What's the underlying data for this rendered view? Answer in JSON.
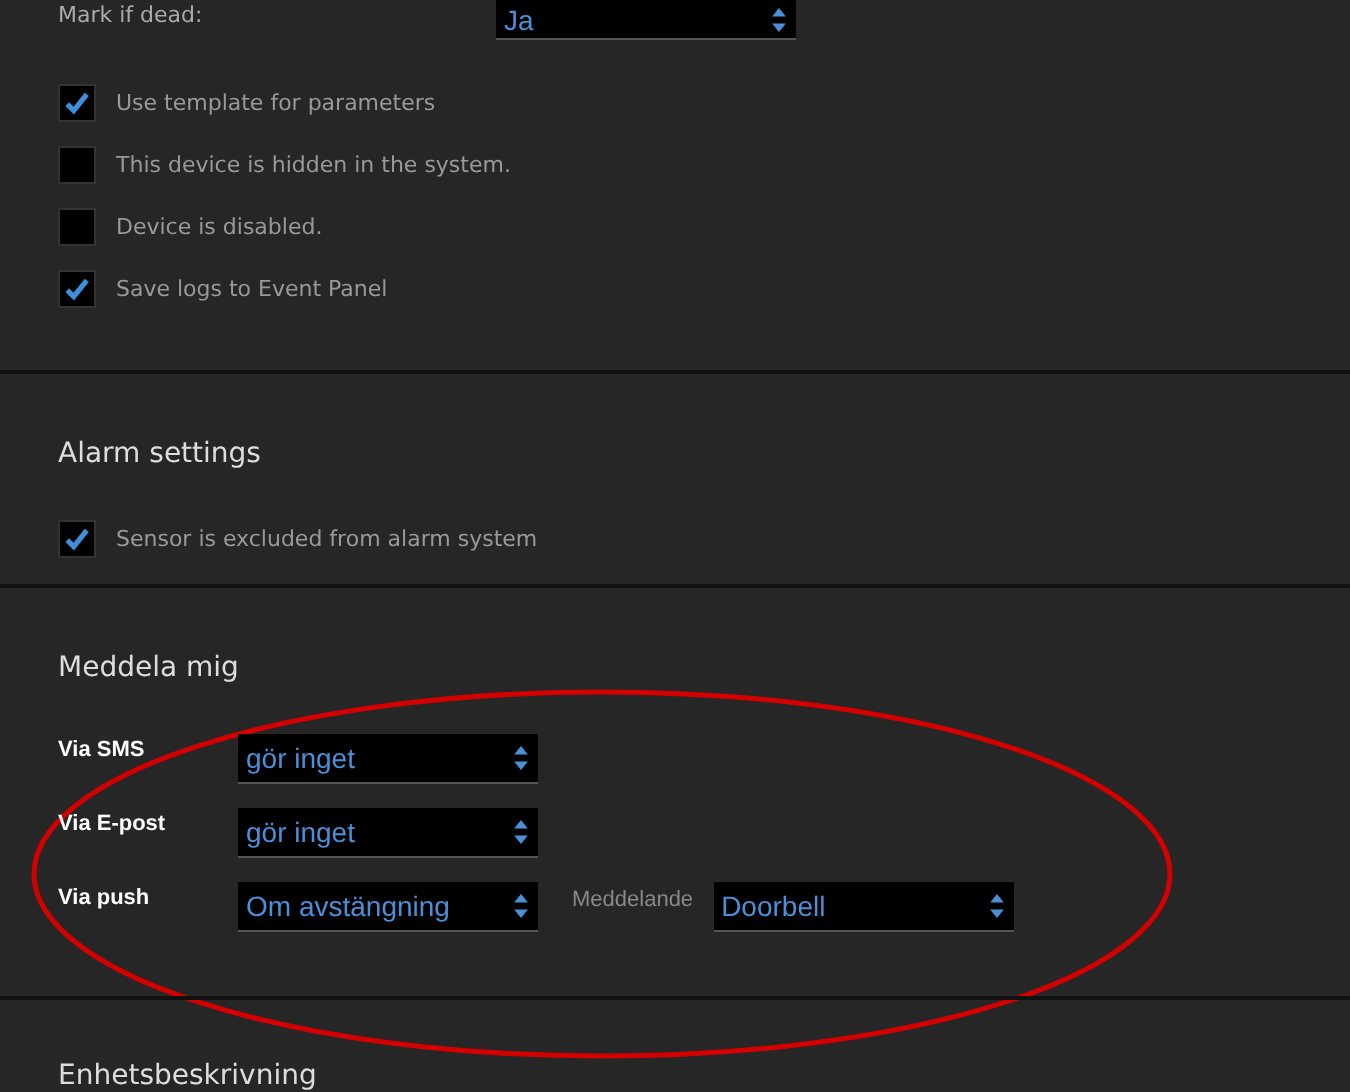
{
  "top_field": {
    "label": "Mark if dead:",
    "value": "Ja"
  },
  "options": [
    {
      "label": "Use template for parameters",
      "checked": true
    },
    {
      "label": "This device is hidden in the system.",
      "checked": false
    },
    {
      "label": "Device is disabled.",
      "checked": false
    },
    {
      "label": "Save logs to Event Panel",
      "checked": true
    }
  ],
  "alarm_settings": {
    "title": "Alarm settings",
    "options": [
      {
        "label": "Sensor is excluded from alarm system",
        "checked": true
      }
    ]
  },
  "notify": {
    "title": "Meddela mig",
    "rows": [
      {
        "label": "Via SMS",
        "value": "gör inget"
      },
      {
        "label": "Via E-post",
        "value": "gör inget"
      },
      {
        "label": "Via push",
        "value": "Om avstängning",
        "extra_label": "Meddelande",
        "extra_value": "Doorbell"
      }
    ]
  },
  "next_section": {
    "title": "Enhetsbeskrivning"
  },
  "annotation": {
    "kind": "ellipse",
    "color": "#d40000"
  }
}
